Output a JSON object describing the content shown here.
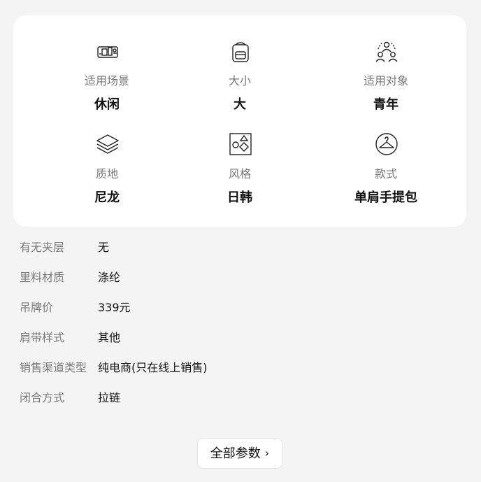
{
  "attributes": [
    {
      "icon": "scene-icon",
      "label": "适用场景",
      "value": "休闲"
    },
    {
      "icon": "backpack-icon",
      "label": "大小",
      "value": "大"
    },
    {
      "icon": "people-icon",
      "label": "适用对象",
      "value": "青年"
    },
    {
      "icon": "layers-icon",
      "label": "质地",
      "value": "尼龙"
    },
    {
      "icon": "shapes-icon",
      "label": "风格",
      "value": "日韩"
    },
    {
      "icon": "hanger-icon",
      "label": "款式",
      "value": "单肩手提包"
    }
  ],
  "specs": [
    {
      "key": "有无夹层",
      "value": "无"
    },
    {
      "key": "里料材质",
      "value": "涤纶"
    },
    {
      "key": "吊牌价",
      "value": "339元"
    },
    {
      "key": "肩带样式",
      "value": "其他"
    },
    {
      "key": "销售渠道类型",
      "value": "纯电商(只在线上销售)"
    },
    {
      "key": "闭合方式",
      "value": "拉链"
    }
  ],
  "all_params_button": {
    "label": "全部参数",
    "chevron": "›"
  }
}
